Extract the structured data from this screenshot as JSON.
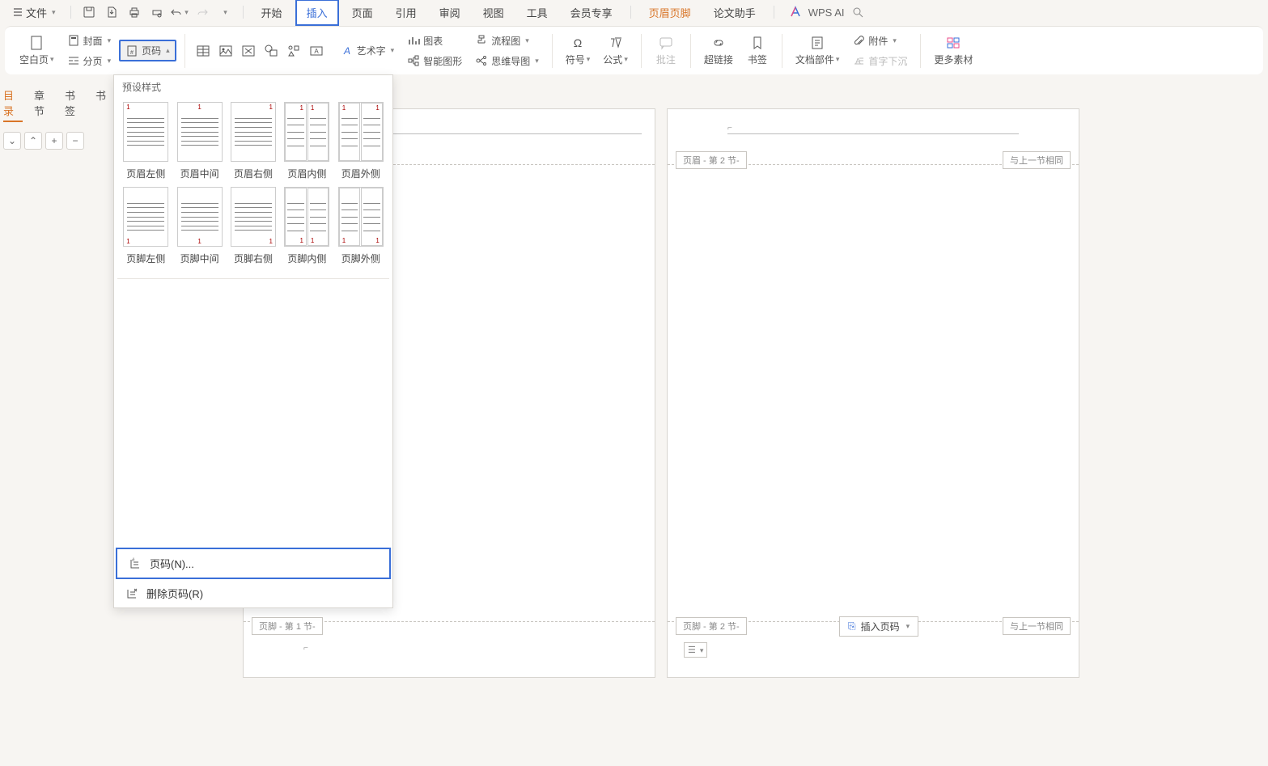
{
  "top": {
    "file_menu": "文件",
    "tabs": [
      "开始",
      "插入",
      "页面",
      "引用",
      "审阅",
      "视图",
      "工具",
      "会员专享"
    ],
    "header_footer": "页眉页脚",
    "thesis": "论文助手",
    "ai": "WPS AI"
  },
  "ribbon": {
    "blank_page": "空白页",
    "cover": "封面",
    "break": "分页",
    "page_number": "页码",
    "chart": "图表",
    "flowchart": "流程图",
    "art_text": "艺术字",
    "smartart": "智能图形",
    "mindmap": "思维导图",
    "symbol": "符号",
    "formula": "公式",
    "comment": "批注",
    "hyperlink": "超链接",
    "bookmark": "书签",
    "doc_part": "文档部件",
    "drop_cap": "首字下沉",
    "attachment": "附件",
    "more": "更多素材"
  },
  "dropdown": {
    "title": "预设样式",
    "presets": [
      "页眉左侧",
      "页眉中间",
      "页眉右侧",
      "页眉内侧",
      "页眉外侧",
      "页脚左侧",
      "页脚中间",
      "页脚右侧",
      "页脚内侧",
      "页脚外侧"
    ],
    "page_number_action": "页码(N)...",
    "delete_action": "删除页码(R)"
  },
  "nav": {
    "tabs": [
      "目录",
      "章节",
      "书签"
    ],
    "trail": "书"
  },
  "doc": {
    "header_sec2": "页眉  - 第 2 节-",
    "same_prev": "与上一节相同",
    "footer_sec1": "页脚  - 第 1 节-",
    "footer_sec2": "页脚  - 第 2 节-",
    "insert_pn": "插入页码"
  }
}
